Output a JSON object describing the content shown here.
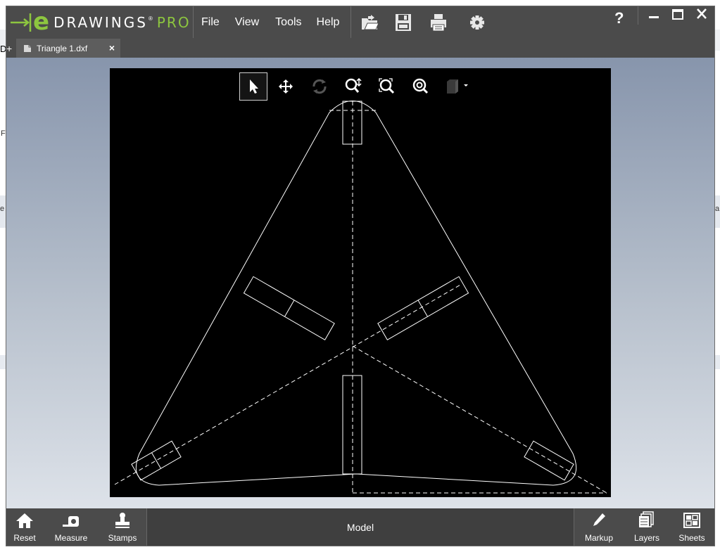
{
  "app": {
    "brand": "DRAWINGS",
    "brand_mark": "e",
    "edition": "PRO"
  },
  "menu": [
    "File",
    "View",
    "Tools",
    "Help"
  ],
  "toolbar_icons": [
    "open-icon",
    "save-icon",
    "print-icon",
    "settings-icon"
  ],
  "help_label": "?",
  "tab": {
    "label": "Triangle 1.dxf",
    "close": "×"
  },
  "view_tools": [
    "select-icon",
    "pan-icon",
    "rotate-icon",
    "zoom-icon",
    "zoom-to-fit-icon",
    "zoom-to-area-icon",
    "view-orientation-icon"
  ],
  "bottom": {
    "reset": "Reset",
    "measure": "Measure",
    "stamps": "Stamps",
    "model": "Model",
    "markup": "Markup",
    "layers": "Layers",
    "sheets": "Sheets"
  },
  "background": {
    "left_glyph_1": "D",
    "left_glyph_2": "F",
    "left_glyph_3": "e",
    "right_glyph": "a"
  },
  "colors": {
    "titlebar": "#4b4b4b",
    "accent": "#8dc63f",
    "canvas": "#000000"
  }
}
